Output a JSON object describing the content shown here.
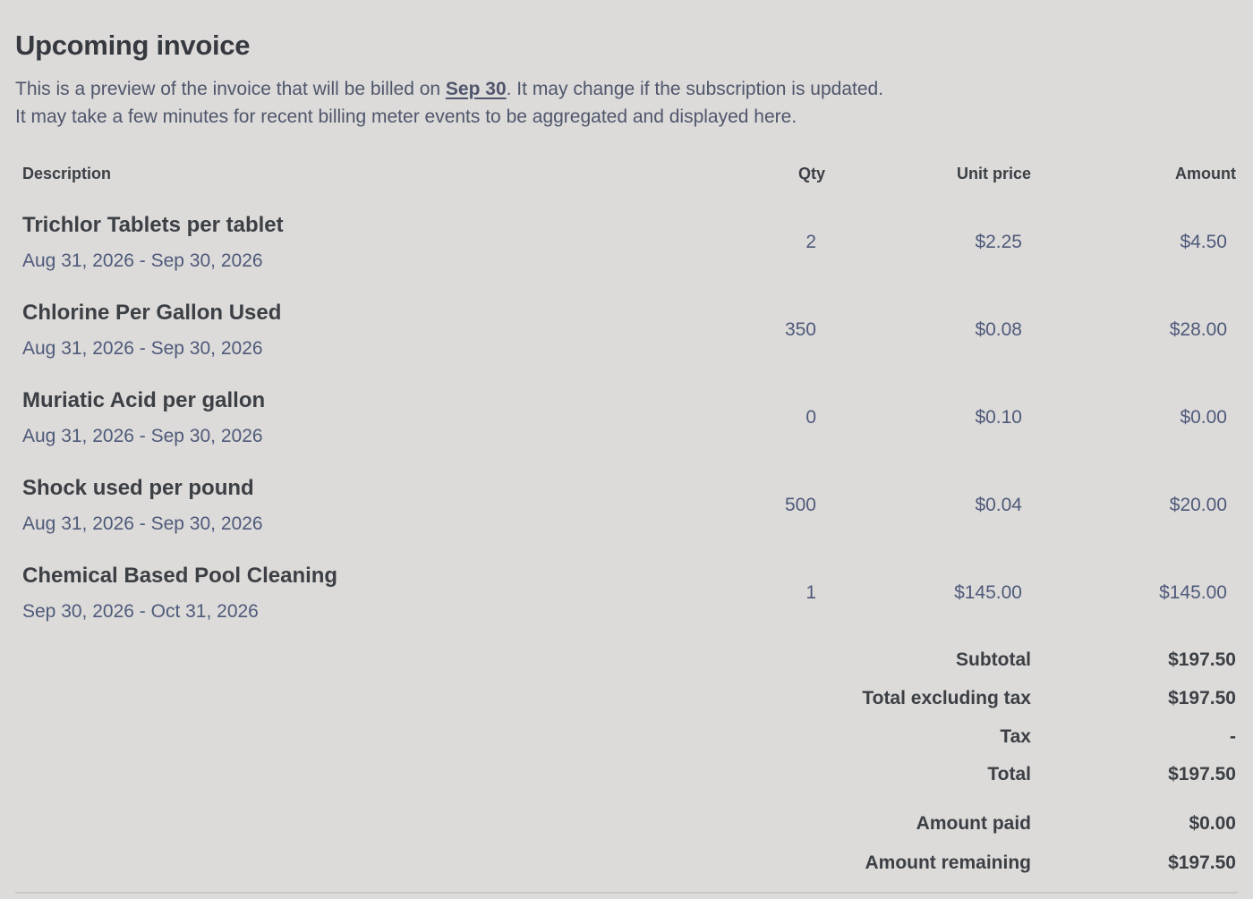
{
  "header": {
    "title": "Upcoming invoice",
    "intro_before": "This is a preview of the invoice that will be billed on ",
    "billing_date": "Sep 30",
    "intro_after": ". It may change if the subscription is updated.",
    "intro_line2": "It may take a few minutes for recent billing meter events to be aggregated and displayed here."
  },
  "table": {
    "columns": {
      "description": "Description",
      "qty": "Qty",
      "unit_price": "Unit price",
      "amount": "Amount"
    },
    "rows": [
      {
        "name": "Trichlor Tablets per tablet",
        "period": "Aug 31, 2026 - Sep 30, 2026",
        "qty": "2",
        "unit_price": "$2.25",
        "amount": "$4.50"
      },
      {
        "name": "Chlorine Per Gallon Used",
        "period": "Aug 31, 2026 - Sep 30, 2026",
        "qty": "350",
        "unit_price": "$0.08",
        "amount": "$28.00"
      },
      {
        "name": "Muriatic Acid per gallon",
        "period": "Aug 31, 2026 - Sep 30, 2026",
        "qty": "0",
        "unit_price": "$0.10",
        "amount": "$0.00"
      },
      {
        "name": "Shock used per pound",
        "period": "Aug 31, 2026 - Sep 30, 2026",
        "qty": "500",
        "unit_price": "$0.04",
        "amount": "$20.00"
      },
      {
        "name": "Chemical Based Pool Cleaning",
        "period": "Sep 30, 2026 - Oct 31, 2026",
        "qty": "1",
        "unit_price": "$145.00",
        "amount": "$145.00"
      }
    ]
  },
  "summary": {
    "subtotal_label": "Subtotal",
    "subtotal_value": "$197.50",
    "total_excl_tax_label": "Total excluding tax",
    "total_excl_tax_value": "$197.50",
    "tax_label": "Tax",
    "tax_value": "-",
    "total_label": "Total",
    "total_value": "$197.50",
    "amount_paid_label": "Amount paid",
    "amount_paid_value": "$0.00",
    "amount_remaining_label": "Amount remaining",
    "amount_remaining_value": "$197.50"
  }
}
